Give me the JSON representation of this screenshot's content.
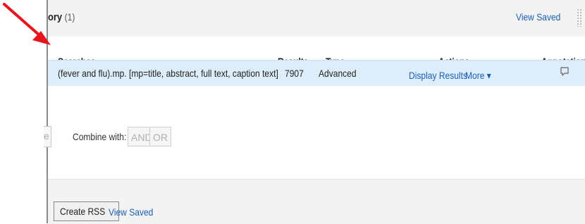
{
  "header": {
    "title_partial": "ory",
    "title_count": "(1)",
    "view_saved": "View Saved"
  },
  "columns": {
    "searches": "Searches",
    "results": "Results",
    "type": "Type",
    "actions": "Actions",
    "annotations": "Annotations"
  },
  "rows": [
    {
      "query": "(fever and flu).mp. [mp=title, abstract, full text, caption text]",
      "results": "7907",
      "type": "Advanced",
      "display_results": "Display Results",
      "more": "More ▾"
    }
  ],
  "combine": {
    "cut_button_text": "e",
    "label": "Combine with:",
    "and": "AND",
    "or": "OR"
  },
  "footer": {
    "create_rss": "Create RSS",
    "view_saved": "View Saved"
  },
  "colors": {
    "link": "#1a5fb4",
    "row_highlight": "#ddeefa",
    "arrow": "#e8141b"
  },
  "icons": {
    "annotation": "comment-icon",
    "arrow": "red-arrow-icon",
    "grip": "drag-handle-icon"
  }
}
